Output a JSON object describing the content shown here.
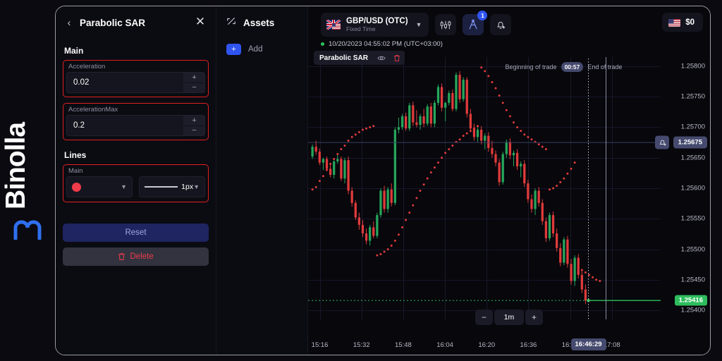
{
  "brand": {
    "name": "Binolla",
    "logo_icon": "binolla-m-logo"
  },
  "settings_panel": {
    "back_icon": "chevron-left-icon",
    "title": "Parabolic SAR",
    "close_icon": "close-icon",
    "main_section_label": "Main",
    "fields": [
      {
        "label": "Acceleration",
        "value": "0.02",
        "plus": "+",
        "minus": "−"
      },
      {
        "label": "AccelerationMax",
        "value": "0.2",
        "plus": "+",
        "minus": "−"
      }
    ],
    "lines_section_label": "Lines",
    "lines_sub_label": "Main",
    "line_color": "#ef3b4a",
    "line_width_label": "1px",
    "chevron_icon": "chevron-down-icon",
    "reset_label": "Reset",
    "delete_label": "Delete",
    "delete_icon": "trash-icon",
    "highlight_color": "#e02020"
  },
  "assets_panel": {
    "icon": "assets-icon",
    "title": "Assets",
    "add_label": "Add",
    "add_icon": "plus-icon"
  },
  "chart_toolbar": {
    "flag_icon": "uk-us-flag-icon",
    "symbol": "GBP/USD (OTC)",
    "symbol_subtitle": "Fixed Time",
    "symbol_chevron_icon": "chevron-down-icon",
    "chart_type_icon": "candlestick-settings-icon",
    "drawing_tools_icon": "drawing-compass-icon",
    "drawing_tools_badge": "1",
    "alert_icon": "alarm-bell-add-icon",
    "balance_flag_icon": "us-flag-icon",
    "balance": "$0"
  },
  "chart_header": {
    "status_dot": "live-dot",
    "timestamp": "10/20/2023  04:55:02 PM  (UTC+03:00)",
    "indicator_chip": {
      "name": "Parabolic SAR",
      "visibility_icon": "eye-icon",
      "delete_icon": "trash-icon"
    }
  },
  "trade_annotation": {
    "begin_label": "Beginning of trade",
    "timer": "00:57",
    "end_label": "End of trade"
  },
  "timeframe_control": {
    "minus": "−",
    "value": "1m",
    "plus": "+"
  },
  "price_scale": {
    "ticks": [
      "1.25800",
      "1.25750",
      "1.25700",
      "1.25650",
      "1.25600",
      "1.25550",
      "1.25500",
      "1.25450",
      "1.25400"
    ],
    "current_price": "1.25416",
    "current_price_color": "#2ebd5d",
    "alert_price": "1.25675",
    "alert_price_color": "#454a6e",
    "alert_icon": "alarm-bell-add-icon"
  },
  "time_scale": {
    "ticks": [
      "15:16",
      "15:32",
      "15:48",
      "16:04",
      "16:20",
      "16:36",
      "16:52",
      "17:08"
    ],
    "cursor_time": "16:46:29"
  },
  "chart_data": {
    "type": "candlestick",
    "title": "GBP/USD (OTC) 1m",
    "xlabel": "",
    "ylabel": "",
    "ylim": [
      1.25385,
      1.25815
    ],
    "xlim": [
      "15:12",
      "17:12"
    ],
    "grid": true,
    "up_color": "#26a65b",
    "down_color": "#e03b3b",
    "sar_color": "#e03b3b",
    "candles": [
      [
        1.25652,
        1.25672,
        1.25648,
        1.25668
      ],
      [
        1.25668,
        1.25678,
        1.25655,
        1.2566
      ],
      [
        1.2566,
        1.25665,
        1.25638,
        1.25642
      ],
      [
        1.25642,
        1.2565,
        1.2563,
        1.25648
      ],
      [
        1.25648,
        1.25652,
        1.25628,
        1.25632
      ],
      [
        1.25632,
        1.2564,
        1.25618,
        1.25622
      ],
      [
        1.25622,
        1.25646,
        1.25616,
        1.25644
      ],
      [
        1.25644,
        1.25655,
        1.2564,
        1.25648
      ],
      [
        1.25648,
        1.25652,
        1.25612,
        1.25616
      ],
      [
        1.25616,
        1.2565,
        1.25608,
        1.25646
      ],
      [
        1.25646,
        1.25652,
        1.2559,
        1.25596
      ],
      [
        1.25596,
        1.25602,
        1.2557,
        1.25576
      ],
      [
        1.25576,
        1.2558,
        1.25548,
        1.25552
      ],
      [
        1.25552,
        1.2556,
        1.25532,
        1.2554
      ],
      [
        1.2554,
        1.25548,
        1.2552,
        1.25526
      ],
      [
        1.25526,
        1.25534,
        1.25508,
        1.25514
      ],
      [
        1.25514,
        1.2554,
        1.25506,
        1.25536
      ],
      [
        1.25536,
        1.25546,
        1.25518,
        1.25522
      ],
      [
        1.25522,
        1.2556,
        1.25518,
        1.25556
      ],
      [
        1.25556,
        1.256,
        1.25552,
        1.25596
      ],
      [
        1.25596,
        1.25604,
        1.2556,
        1.25566
      ],
      [
        1.25566,
        1.25602,
        1.2556,
        1.25598
      ],
      [
        1.25598,
        1.25608,
        1.2557,
        1.25576
      ],
      [
        1.25576,
        1.257,
        1.25572,
        1.25696
      ],
      [
        1.25696,
        1.25716,
        1.2569,
        1.257
      ],
      [
        1.257,
        1.25722,
        1.25696,
        1.25718
      ],
      [
        1.25718,
        1.25724,
        1.25694,
        1.25698
      ],
      [
        1.25698,
        1.2574,
        1.25694,
        1.25736
      ],
      [
        1.25736,
        1.25742,
        1.25702,
        1.25708
      ],
      [
        1.25708,
        1.25728,
        1.257,
        1.25704
      ],
      [
        1.25704,
        1.25722,
        1.25696,
        1.25718
      ],
      [
        1.25718,
        1.2573,
        1.257,
        1.25706
      ],
      [
        1.25706,
        1.25738,
        1.25702,
        1.25734
      ],
      [
        1.25734,
        1.2574,
        1.257,
        1.25706
      ],
      [
        1.25706,
        1.25744,
        1.257,
        1.2574
      ],
      [
        1.2574,
        1.2577,
        1.25736,
        1.25766
      ],
      [
        1.25766,
        1.25772,
        1.25726,
        1.25732
      ],
      [
        1.25732,
        1.25742,
        1.2571,
        1.2574
      ],
      [
        1.2574,
        1.2576,
        1.25736,
        1.25756
      ],
      [
        1.25756,
        1.25762,
        1.25726,
        1.2573
      ],
      [
        1.2573,
        1.2579,
        1.25726,
        1.25786
      ],
      [
        1.25786,
        1.25792,
        1.2574,
        1.25746
      ],
      [
        1.25746,
        1.25782,
        1.25742,
        1.25778
      ],
      [
        1.25778,
        1.25782,
        1.25716,
        1.25722
      ],
      [
        1.25722,
        1.2573,
        1.25692,
        1.25698
      ],
      [
        1.25698,
        1.25706,
        1.25678,
        1.25684
      ],
      [
        1.25684,
        1.257,
        1.25676,
        1.25696
      ],
      [
        1.25696,
        1.25702,
        1.25672,
        1.25678
      ],
      [
        1.25678,
        1.2569,
        1.25664,
        1.25686
      ],
      [
        1.25686,
        1.25692,
        1.2566,
        1.25666
      ],
      [
        1.25666,
        1.25678,
        1.2565,
        1.25656
      ],
      [
        1.25656,
        1.25662,
        1.25636,
        1.25642
      ],
      [
        1.25642,
        1.25648,
        1.25604,
        1.2561
      ],
      [
        1.2561,
        1.2566,
        1.25606,
        1.25656
      ],
      [
        1.25656,
        1.2568,
        1.2565,
        1.25676
      ],
      [
        1.25676,
        1.25682,
        1.25648,
        1.25654
      ],
      [
        1.25654,
        1.25662,
        1.25636,
        1.25658
      ],
      [
        1.25658,
        1.25664,
        1.2563,
        1.25636
      ],
      [
        1.25636,
        1.25644,
        1.25618,
        1.2564
      ],
      [
        1.2564,
        1.25646,
        1.25602,
        1.25608
      ],
      [
        1.25608,
        1.25614,
        1.25576,
        1.25582
      ],
      [
        1.25582,
        1.2559,
        1.2556,
        1.25566
      ],
      [
        1.25566,
        1.256,
        1.25556,
        1.25596
      ],
      [
        1.25596,
        1.25602,
        1.2557,
        1.25576
      ],
      [
        1.25576,
        1.25582,
        1.2554,
        1.25546
      ],
      [
        1.25546,
        1.25552,
        1.25512,
        1.25518
      ],
      [
        1.25518,
        1.2556,
        1.25514,
        1.25556
      ],
      [
        1.25556,
        1.25562,
        1.2552,
        1.25526
      ],
      [
        1.25526,
        1.25534,
        1.25496,
        1.25502
      ],
      [
        1.25502,
        1.2551,
        1.25472,
        1.25478
      ],
      [
        1.25478,
        1.2552,
        1.25474,
        1.25516
      ],
      [
        1.25516,
        1.25522,
        1.2547,
        1.25476
      ],
      [
        1.25476,
        1.25484,
        1.25442,
        1.25448
      ],
      [
        1.25448,
        1.2549,
        1.2544,
        1.25486
      ],
      [
        1.25486,
        1.25492,
        1.25452,
        1.25458
      ],
      [
        1.25458,
        1.25466,
        1.25428,
        1.25434
      ],
      [
        1.25434,
        1.25442,
        1.2541,
        1.25416
      ]
    ],
    "sar_points": [
      1.25598,
      1.25602,
      1.25612,
      1.2562,
      1.2563,
      1.2564,
      1.25648,
      1.25656,
      1.25664,
      1.2567,
      1.25678,
      1.25684,
      1.25688,
      1.25692,
      1.25696,
      1.25698,
      1.257,
      1.25702,
      1.2549,
      1.25492,
      1.25496,
      1.255,
      1.25506,
      1.25514,
      1.25524,
      1.25536,
      1.25548,
      1.2556,
      1.25572,
      1.25584,
      1.25596,
      1.25606,
      1.25616,
      1.25626,
      1.25634,
      1.25642,
      1.2565,
      1.25658,
      1.25664,
      1.2567,
      1.25676,
      1.2568,
      1.25686,
      1.2569,
      1.25694,
      1.25698,
      1.25702,
      1.25798,
      1.25792,
      1.25784,
      1.25774,
      1.25764,
      1.25752,
      1.2574,
      1.25728,
      1.25718,
      1.25708,
      1.257,
      1.25694,
      1.25688,
      1.25684,
      1.2568,
      1.25676,
      1.25672,
      1.25668,
      1.25664,
      1.25598,
      1.256,
      1.25604,
      1.2561,
      1.25616,
      1.25624,
      1.25632,
      1.25642,
      1.2547,
      1.25466,
      1.25462,
      1.25458,
      1.25454,
      1.2545,
      1.25448
    ]
  }
}
